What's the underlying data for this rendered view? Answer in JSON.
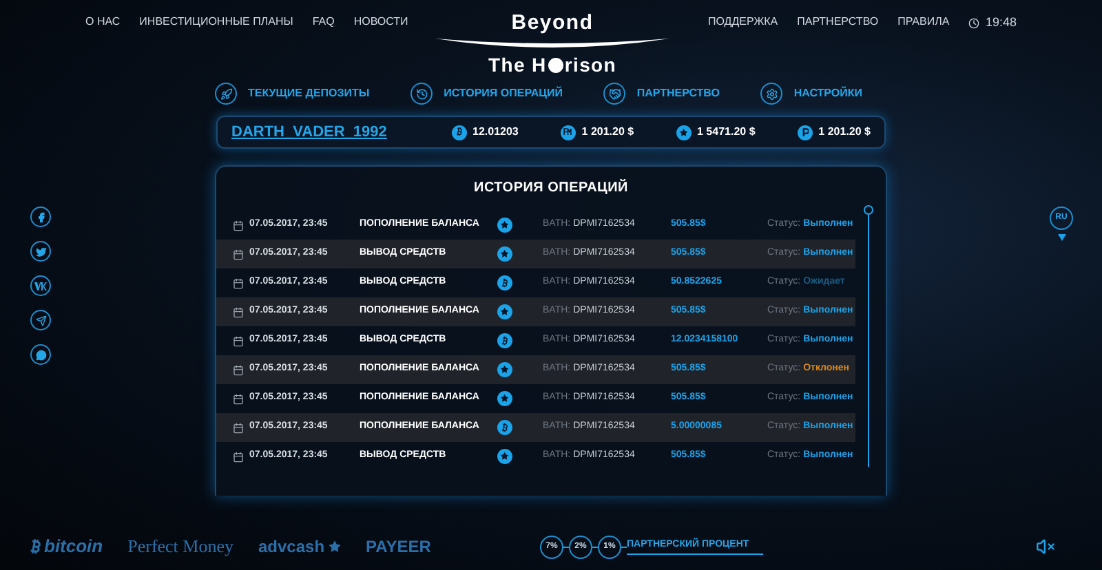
{
  "nav_left": [
    "О НАС",
    "ИНВЕСТИЦИОННЫЕ ПЛАНЫ",
    "FAQ",
    "НОВОСТИ"
  ],
  "logo": {
    "top": "Beyond",
    "bottom_before": "The H",
    "bottom_after": "rison"
  },
  "nav_right": [
    "ПОДДЕРЖКА",
    "ПАРТНЕРСТВО",
    "ПРАВИЛА"
  ],
  "clock": "19:48",
  "actions": [
    {
      "kind": "rocket",
      "label": "ТЕКУЩИЕ ДЕПОЗИТЫ"
    },
    {
      "kind": "history",
      "label": "ИСТОРИЯ ОПЕРАЦИЙ"
    },
    {
      "kind": "handshake",
      "label": "ПАРТНЕРСТВО"
    },
    {
      "kind": "gear",
      "label": "НАСТРОЙКИ"
    }
  ],
  "user": {
    "name": "DARTH_VADER_1992",
    "balances": [
      {
        "kind": "bitcoin",
        "amount": "12.01203"
      },
      {
        "kind": "pm",
        "amount": "1 201.20 $"
      },
      {
        "kind": "star",
        "amount": "1 5471.20 $"
      },
      {
        "kind": "payeer",
        "amount": "1 201.20 $"
      }
    ]
  },
  "history": {
    "title": "ИСТОРИЯ ОПЕРАЦИЙ",
    "rows": [
      {
        "date": "07.05.2017, 23:45",
        "type": "ПОПОЛНЕНИЕ БАЛАНСА",
        "coin": {
          "kind": "star"
        },
        "batch_label": "BATH:",
        "batch": "DPMI7162534",
        "amount": "505.85$",
        "status_label": "Статус:",
        "status": {
          "kind": "done",
          "text": "Выполнен"
        }
      },
      {
        "date": "07.05.2017, 23:45",
        "type": "ВЫВОД СРЕДСТВ",
        "coin": {
          "kind": "star"
        },
        "batch_label": "BATH:",
        "batch": "DPMI7162534",
        "amount": "505.85$",
        "status_label": "Статус:",
        "status": {
          "kind": "done",
          "text": "Выполнен"
        }
      },
      {
        "date": "07.05.2017, 23:45",
        "type": "ВЫВОД СРЕДСТВ",
        "coin": {
          "kind": "bitcoin"
        },
        "batch_label": "BATH:",
        "batch": "DPMI7162534",
        "amount": "50.8522625",
        "status_label": "Статус:",
        "status": {
          "kind": "pending",
          "text": "Ожидает"
        }
      },
      {
        "date": "07.05.2017, 23:45",
        "type": "ПОПОЛНЕНИЕ БАЛАНСА",
        "coin": {
          "kind": "star"
        },
        "batch_label": "BATH:",
        "batch": "DPMI7162534",
        "amount": "505.85$",
        "status_label": "Статус:",
        "status": {
          "kind": "done",
          "text": "Выполнен"
        }
      },
      {
        "date": "07.05.2017, 23:45",
        "type": "ВЫВОД СРЕДСТВ",
        "coin": {
          "kind": "bitcoin"
        },
        "batch_label": "BATH:",
        "batch": "DPMI7162534",
        "amount": "12.0234158100",
        "status_label": "Статус:",
        "status": {
          "kind": "done",
          "text": "Выполнен"
        }
      },
      {
        "date": "07.05.2017, 23:45",
        "type": "ПОПОЛНЕНИЕ БАЛАНСА",
        "coin": {
          "kind": "star"
        },
        "batch_label": "BATH:",
        "batch": "DPMI7162534",
        "amount": "505.85$",
        "status_label": "Статус:",
        "status": {
          "kind": "rejected",
          "text": "Отклонен"
        }
      },
      {
        "date": "07.05.2017, 23:45",
        "type": "ПОПОЛНЕНИЕ БАЛАНСА",
        "coin": {
          "kind": "star"
        },
        "batch_label": "BATH:",
        "batch": "DPMI7162534",
        "amount": "505.85$",
        "status_label": "Статус:",
        "status": {
          "kind": "done",
          "text": "Выполнен"
        }
      },
      {
        "date": "07.05.2017, 23:45",
        "type": "ПОПОЛНЕНИЕ БАЛАНСА",
        "coin": {
          "kind": "bitcoin"
        },
        "batch_label": "BATH:",
        "batch": "DPMI7162534",
        "amount": "5.00000085",
        "status_label": "Статус:",
        "status": {
          "kind": "done",
          "text": "Выполнен"
        }
      },
      {
        "date": "07.05.2017, 23:45",
        "type": "ВЫВОД СРЕДСТВ",
        "coin": {
          "kind": "star"
        },
        "batch_label": "BATH:",
        "batch": "DPMI7162534",
        "amount": "505.85$",
        "status_label": "Статус:",
        "status": {
          "kind": "done",
          "text": "Выполнен"
        }
      }
    ]
  },
  "social": [
    {
      "kind": "facebook"
    },
    {
      "kind": "twitter"
    },
    {
      "kind": "vk"
    },
    {
      "kind": "telegram"
    },
    {
      "kind": "chat"
    }
  ],
  "language": "RU",
  "payment_logos": [
    {
      "kind": "bitcoin",
      "text": "bitcoin"
    },
    {
      "kind": "serif",
      "text": "Perfect Money"
    },
    {
      "kind": "star",
      "text": "advcash"
    },
    {
      "kind": "plain",
      "text": "PAYEER"
    }
  ],
  "referral": {
    "levels": [
      "7%",
      "2%",
      "1%"
    ],
    "label": "ПАРТНЕРСКИЙ ПРОЦЕНТ"
  }
}
